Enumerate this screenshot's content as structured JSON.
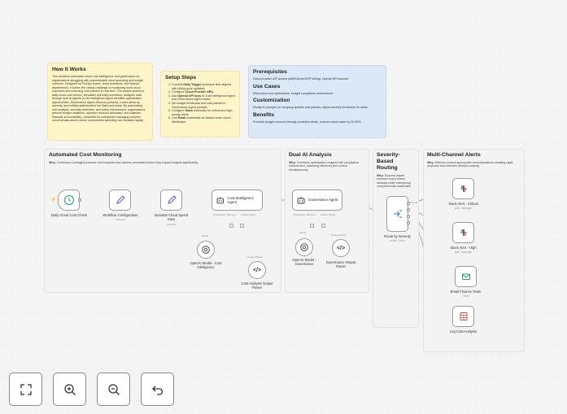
{
  "notes": {
    "how_it_works": {
      "title": "How It Works",
      "body": "This workflow automates cloud cost intelligence and governance for organizations struggling with unpredictable cloud spending and budget overruns. Designed for FinOps teams, cloud architects, and finance departments, it solves the critical challenge of monitoring multi-cloud expenses and enforcing cost policies in real-time. The system performs daily cloud cost checks, simulates spending scenarios, analyzes data through dual AI agents (Cost Intelligence Agent identifies optimization opportunities, Governance Agent enforces policies), routes alerts by severity, and notifies stakeholders via Slack and email. By automating cost analysis, anomaly detection, and policy enforcement, organizations prevent budget violations, optimize resource allocation, and maintain financial accountability—essential for enterprises managing complex cloud infrastructures where uncontrolled spending can escalate rapidly."
    },
    "setup_steps": {
      "title": "Setup Steps",
      "items": [
        [
          "Connect ",
          "Daily Trigger",
          " (schedule time aligned with billing cycle updates)"
        ],
        [
          "Configure ",
          "Cloud Provider APIs",
          ""
        ],
        [
          "Add ",
          "OpenAI API keys",
          " to Cost Intelligence Agent and Governance Agent nodes"
        ],
        [
          "Set budget thresholds and cost policies in Governance Agent prompts",
          "",
          ""
        ],
        [
          "Configure ",
          "Slack",
          " webhooks for critical and high-priority alerts"
        ],
        [
          "Link ",
          "Email",
          " credentials for finance team report distribution"
        ]
      ]
    },
    "prerequisites": {
      "title": "Prerequisites",
      "body": "Cloud provider API access (AWS/Azure/GCP billing), OpenAI API account",
      "use_cases_title": "Use Cases",
      "use_cases_body": "Multi-cloud cost optimization, budget compliance enforcement",
      "customization_title": "Customization",
      "customization_body": "Modify AI prompts for company-specific cost policies, adjust severity thresholds for alerts",
      "benefits_title": "Benefits",
      "benefits_body": "Prevents budget overruns through proactive alerts, reduces cloud waste by 30-50%"
    }
  },
  "sections": {
    "monitoring": {
      "title": "Automated Cost Monitoring",
      "why_label": "Why:",
      "why": " Continuous oversight prevents cost surprises and catches anomalies before they impact budgets significantly"
    },
    "dual_ai": {
      "title": "Dual AI Analysis",
      "why_label": "Why:",
      "why": " Combines optimization insights with compliance enforcement, balancing efficiency and control simultaneously"
    },
    "severity": {
      "title": "Severity-Based Routing",
      "why_label": "Why:",
      "why": " Ensures urgent overruns reach teams instantly while maintaining comprehensive audit trails"
    },
    "alerts": {
      "title": "Multi-Channel Alerts",
      "why_label": "Why:",
      "why": " Delivers context-appropriate communications enabling rapid response and informed decision-making"
    }
  },
  "nodes": {
    "trigger": {
      "label": "Daily Cloud Cost Check"
    },
    "workflow_config": {
      "label": "Workflow Configuration",
      "sub": "manual"
    },
    "simulate": {
      "label": "Simulate Cloud Spend Data",
      "sub": "manual"
    },
    "cost_agent": {
      "label": "Cost Intelligence Agent",
      "port_model": "Chat Model",
      "port_memory": "Memory",
      "port_parser": "Output Parser"
    },
    "governance_agent": {
      "label": "Governance Agent",
      "port_model": "Chat Model",
      "port_memory": "Memory",
      "port_parser": "Output Parser"
    },
    "openai_cost": {
      "label": "OpenAI Model - Cost Intelligence",
      "edge": "Model"
    },
    "cost_parser": {
      "label": "Cost Analysis Output Parser",
      "edge": "Output Parser"
    },
    "openai_gov": {
      "label": "OpenAI Model - Governance",
      "edge": "Model"
    },
    "gov_parser": {
      "label": "Governance Output Parser",
      "edge": "Output Parser"
    },
    "router": {
      "label": "Route by Severity",
      "sub": "mode: Rules",
      "out_label": "Critical"
    },
    "slack_critical": {
      "label": "Slack Alert - Critical",
      "sub": "post: message"
    },
    "slack_high": {
      "label": "Slack Alert - High",
      "sub": "post: message"
    },
    "email": {
      "label": "Email Finance Team",
      "sub": "Send"
    },
    "log": {
      "label": "Log Cost Analysis"
    }
  },
  "controls": {
    "fit": "fit-view-icon",
    "zoom_in": "zoom-in-icon",
    "zoom_out": "zoom-out-icon",
    "undo": "undo-icon"
  },
  "colors": {
    "sticky_yellow": "#fff5c8",
    "sticky_blue": "#dbe8f7",
    "sticky_gray": "#f3f3f3",
    "trigger_green": "#2fb07d",
    "accent_purple": "#5b5fd6",
    "router_blue": "#3a7bd5",
    "email_green": "#2e9e63",
    "sheets_red": "#d9534f"
  }
}
